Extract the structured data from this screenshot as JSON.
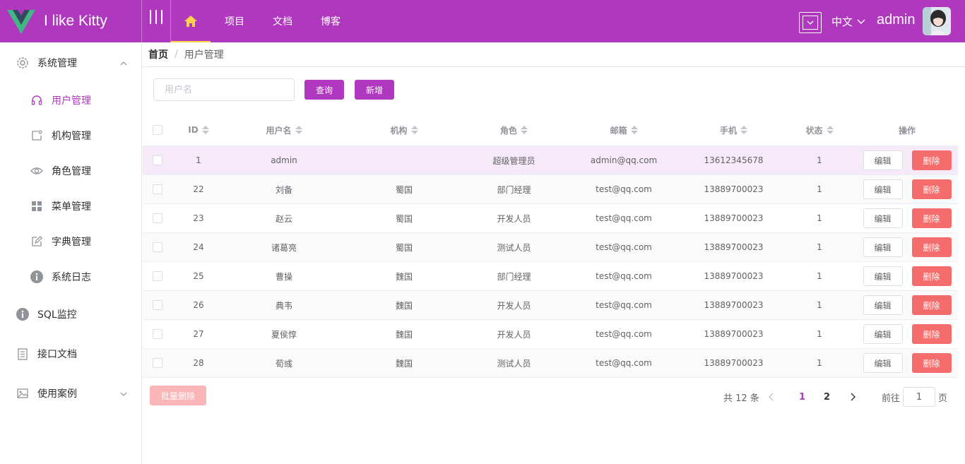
{
  "app": {
    "title": "I like Kitty",
    "brand_color": "#b038bf",
    "accent": "#ffd04b"
  },
  "nav": {
    "home_icon": "home-icon",
    "items": [
      "项目",
      "文档",
      "博客"
    ]
  },
  "header": {
    "language": "中文",
    "user": "admin"
  },
  "sidebar": {
    "groups": [
      {
        "label": "系统管理",
        "icon": "gear-icon",
        "expanded": true,
        "items": [
          {
            "label": "用户管理",
            "icon": "headset-icon",
            "active": true
          },
          {
            "label": "机构管理",
            "icon": "org-icon"
          },
          {
            "label": "角色管理",
            "icon": "eye-icon"
          },
          {
            "label": "菜单管理",
            "icon": "grid-icon"
          },
          {
            "label": "字典管理",
            "icon": "edit-icon"
          },
          {
            "label": "系统日志",
            "icon": "info-icon"
          }
        ]
      },
      {
        "label": "SQL监控",
        "icon": "info-icon"
      },
      {
        "label": "接口文档",
        "icon": "document-icon"
      },
      {
        "label": "使用案例",
        "icon": "picture-icon",
        "expanded": false
      }
    ]
  },
  "breadcrumb": {
    "home": "首页",
    "separator": "/",
    "current": "用户管理"
  },
  "toolbar": {
    "search_placeholder": "用户名",
    "query": "查询",
    "add": "新增"
  },
  "table": {
    "columns": [
      "ID",
      "用户名",
      "机构",
      "角色",
      "邮箱",
      "手机",
      "状态",
      "操作"
    ],
    "edit_label": "编辑",
    "delete_label": "删除",
    "rows": [
      {
        "id": "1",
        "name": "admin",
        "org": "",
        "role": "超级管理员",
        "email": "admin@qq.com",
        "phone": "13612345678",
        "status": "1"
      },
      {
        "id": "22",
        "name": "刘备",
        "org": "蜀国",
        "role": "部门经理",
        "email": "test@qq.com",
        "phone": "13889700023",
        "status": "1"
      },
      {
        "id": "23",
        "name": "赵云",
        "org": "蜀国",
        "role": "开发人员",
        "email": "test@qq.com",
        "phone": "13889700023",
        "status": "1"
      },
      {
        "id": "24",
        "name": "诸葛亮",
        "org": "蜀国",
        "role": "测试人员",
        "email": "test@qq.com",
        "phone": "13889700023",
        "status": "1"
      },
      {
        "id": "25",
        "name": "曹操",
        "org": "魏国",
        "role": "部门经理",
        "email": "test@qq.com",
        "phone": "13889700023",
        "status": "1"
      },
      {
        "id": "26",
        "name": "典韦",
        "org": "魏国",
        "role": "开发人员",
        "email": "test@qq.com",
        "phone": "13889700023",
        "status": "1"
      },
      {
        "id": "27",
        "name": "夏侯惇",
        "org": "魏国",
        "role": "开发人员",
        "email": "test@qq.com",
        "phone": "13889700023",
        "status": "1"
      },
      {
        "id": "28",
        "name": "荀彧",
        "org": "魏国",
        "role": "测试人员",
        "email": "test@qq.com",
        "phone": "13889700023",
        "status": "1"
      }
    ]
  },
  "footer": {
    "batch_delete": "批量删除",
    "total": "共 12 条",
    "pages": [
      "1",
      "2"
    ],
    "current_page": "1",
    "goto_label": "前往",
    "goto_value": "1",
    "page_unit": "页"
  }
}
